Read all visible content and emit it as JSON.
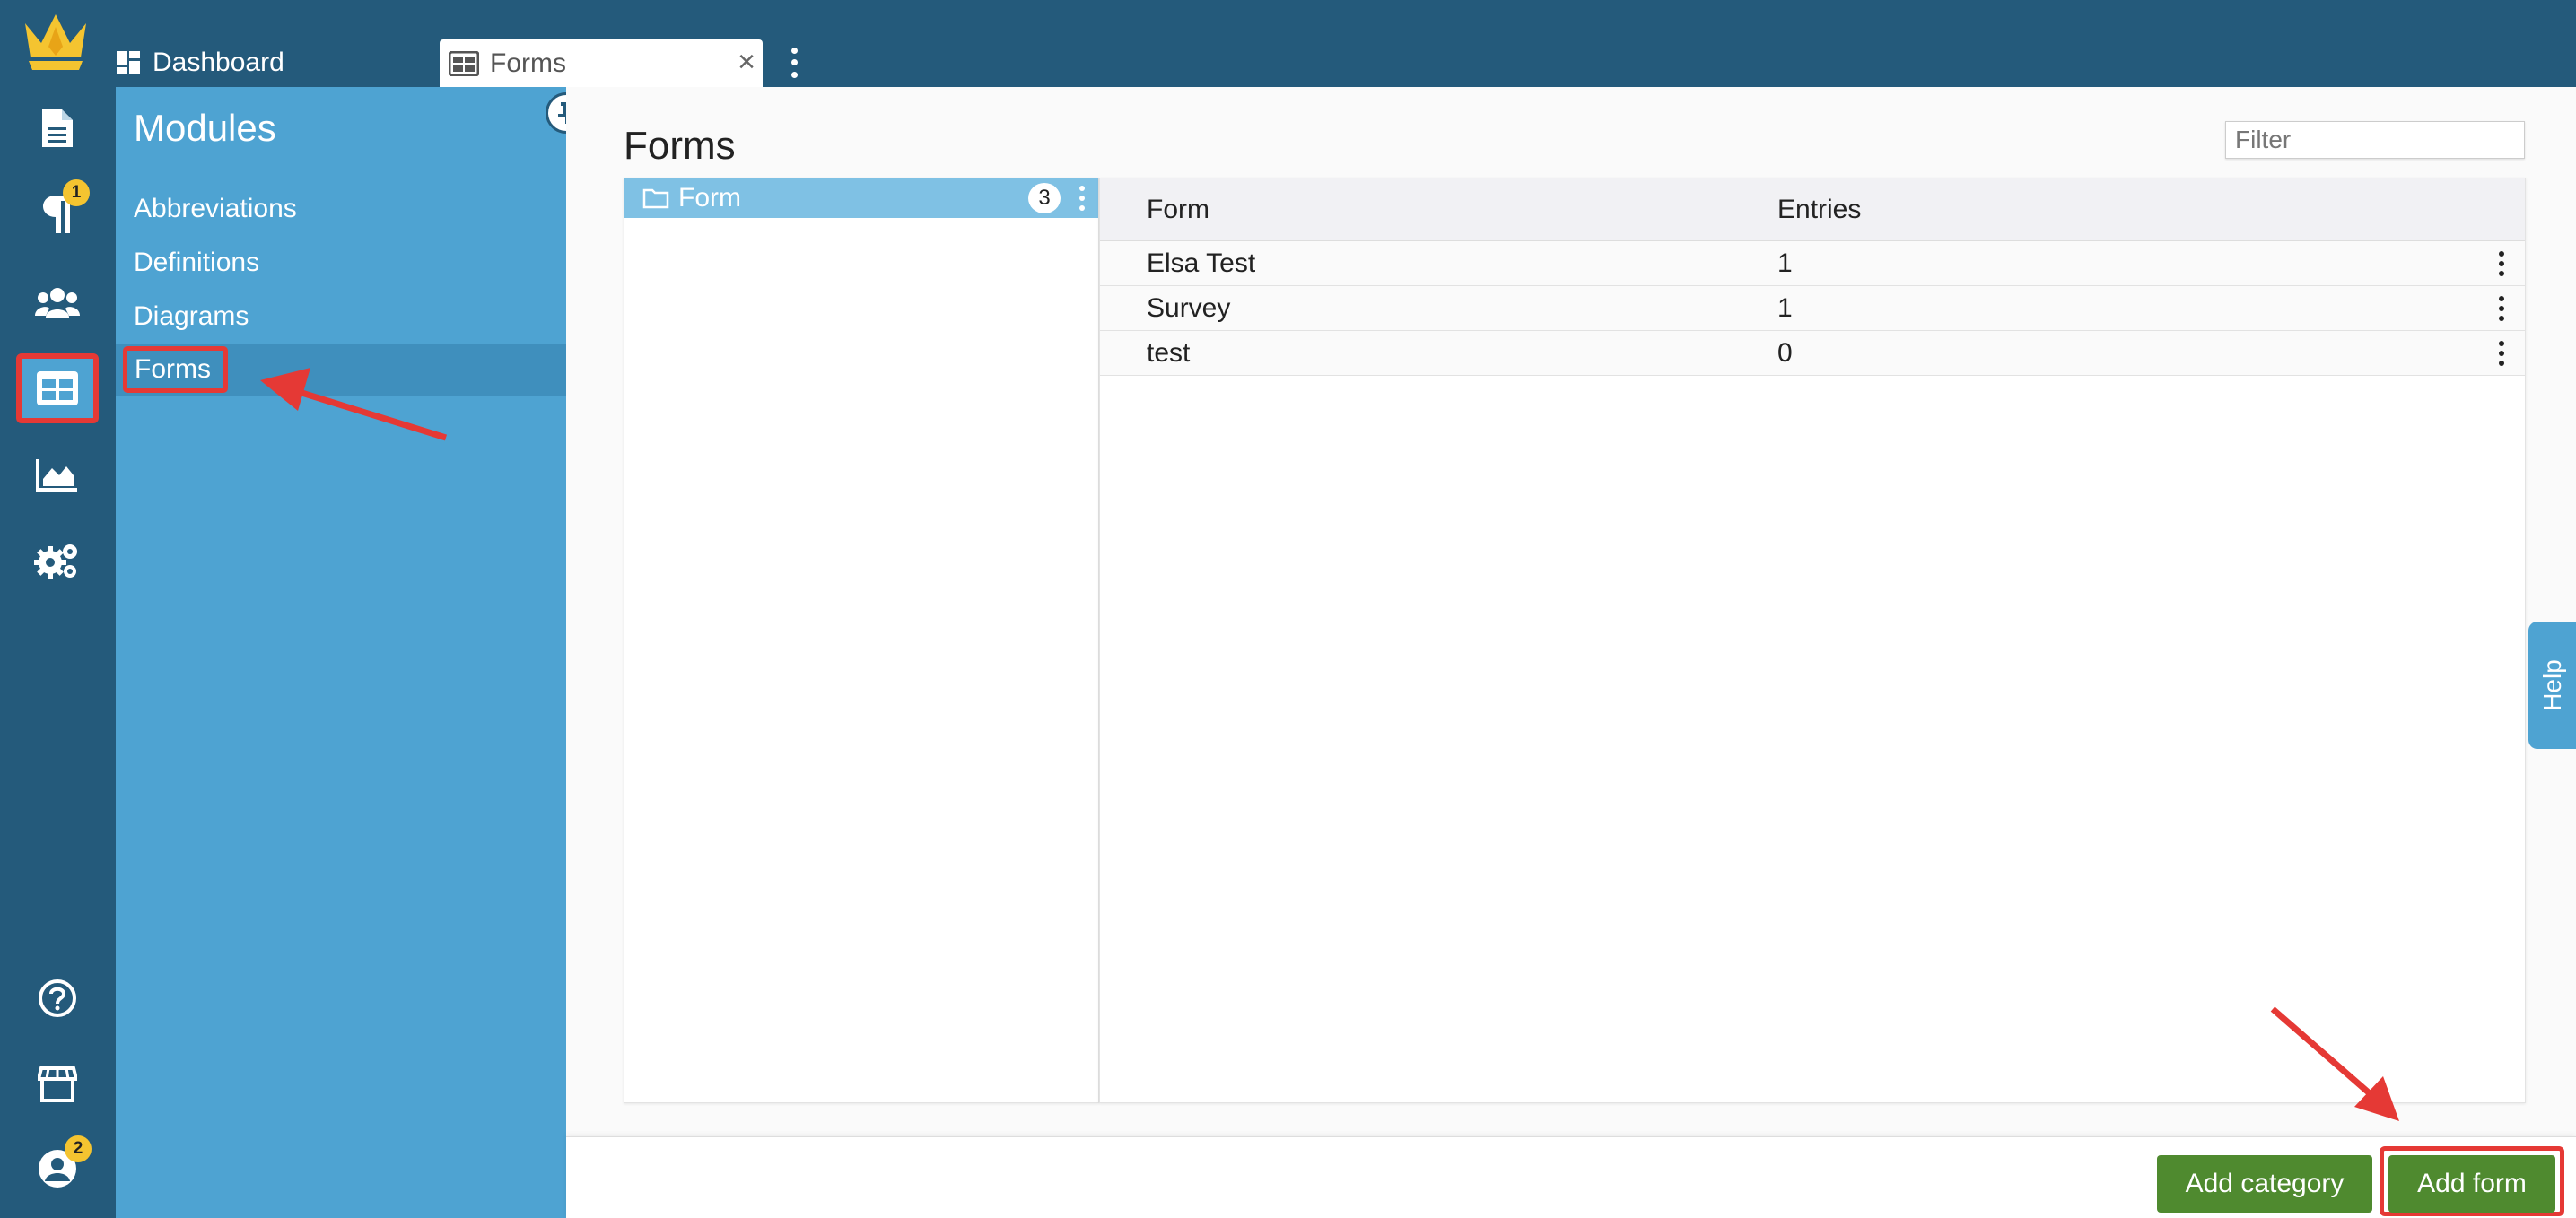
{
  "tabs": {
    "dashboard_label": "Dashboard",
    "forms_label": "Forms"
  },
  "rail": {
    "items": [
      {
        "icon": "document-icon"
      },
      {
        "icon": "paragraph-icon",
        "badge": "1"
      },
      {
        "icon": "users-icon"
      },
      {
        "icon": "forms-grid-icon",
        "active": true
      },
      {
        "icon": "chart-icon"
      },
      {
        "icon": "settings-icon"
      },
      {
        "icon": "help-circle-icon"
      },
      {
        "icon": "store-icon"
      },
      {
        "icon": "account-icon",
        "badge": "2"
      }
    ]
  },
  "modules": {
    "title": "Modules",
    "items": [
      "Abbreviations",
      "Definitions",
      "Diagrams",
      "Forms"
    ],
    "selected": "Forms"
  },
  "main": {
    "title": "Forms",
    "filter_placeholder": "Filter",
    "tree": {
      "label": "Form",
      "count": "3"
    },
    "table": {
      "headers": [
        "Form",
        "Entries"
      ],
      "rows": [
        {
          "form": "Elsa Test",
          "entries": "1"
        },
        {
          "form": "Survey",
          "entries": "1"
        },
        {
          "form": "test",
          "entries": "0"
        }
      ]
    },
    "buttons": {
      "add_category": "Add category",
      "add_form": "Add form"
    },
    "help_label": "Help"
  },
  "colors": {
    "topbar": "#245a7b",
    "panel": "#4ea3d2",
    "accent_green": "#4f8a2f",
    "highlight_red": "#e53935",
    "badge_yellow": "#f4c430"
  }
}
